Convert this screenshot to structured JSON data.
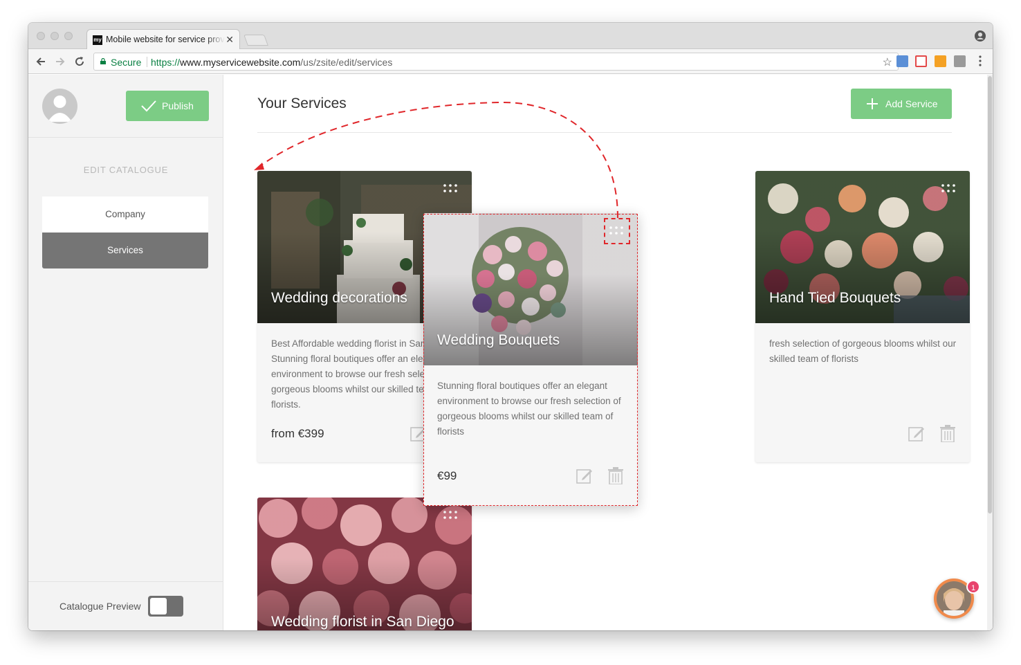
{
  "browser": {
    "tab_title": "Mobile website for service providers",
    "tab_favicon": "my",
    "secure_label": "Secure",
    "url_scheme": "https://",
    "url_host": "www.myservicewebsite.com",
    "url_path": "/us/zsite/edit/services"
  },
  "sidebar": {
    "publish_label": "Publish",
    "section_title": "EDIT CATALOGUE",
    "items": [
      {
        "label": "Company",
        "active": false
      },
      {
        "label": "Services",
        "active": true
      }
    ],
    "preview_label": "Catalogue Preview",
    "preview_on": false
  },
  "main": {
    "title": "Your Services",
    "add_label": "Add Service"
  },
  "cards": [
    {
      "title": "Wedding decorations",
      "description": "Best Affordable wedding florist in San Diego. Stunning floral boutiques offer an elegant environment to browse our fresh selection of gorgeous blooms whilst our skilled team of florists.",
      "price": "from €399"
    },
    {
      "title": "Wedding Bouquets",
      "description": "Stunning floral boutiques offer an elegant environment to browse our fresh selection of gorgeous blooms whilst our skilled team of florists",
      "price": "€99"
    },
    {
      "title": "Hand Tied Bouquets",
      "description": "fresh selection of gorgeous blooms whilst our skilled team of florists",
      "price": ""
    },
    {
      "title": "Wedding florist in San Diego",
      "description": "",
      "price": ""
    }
  ],
  "chat": {
    "badge_count": "1"
  },
  "colors": {
    "accent_green": "#7ccc85",
    "drag_guide_red": "#e0262a",
    "active_nav": "#757575",
    "secure_green": "#0b8043"
  }
}
